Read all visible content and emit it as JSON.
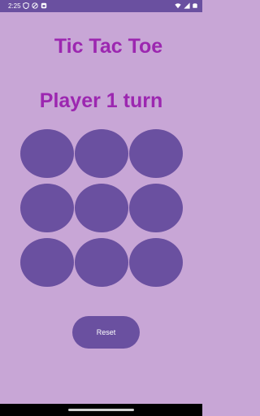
{
  "status_bar": {
    "time": "2:25",
    "left_icons": [
      "shield-icon",
      "settings-circle-icon",
      "sim-card-icon"
    ],
    "right_icons": [
      "wifi-icon",
      "signal-icon",
      "battery-icon"
    ]
  },
  "title": "Tic Tac Toe",
  "turn_text": "Player 1 turn",
  "board": {
    "cells": [
      "",
      "",
      "",
      "",
      "",
      "",
      "",
      "",
      ""
    ]
  },
  "reset_label": "Reset",
  "colors": {
    "background": "#c8a6d6",
    "primary": "#6a50a0",
    "accent_text": "#9c27b0"
  }
}
